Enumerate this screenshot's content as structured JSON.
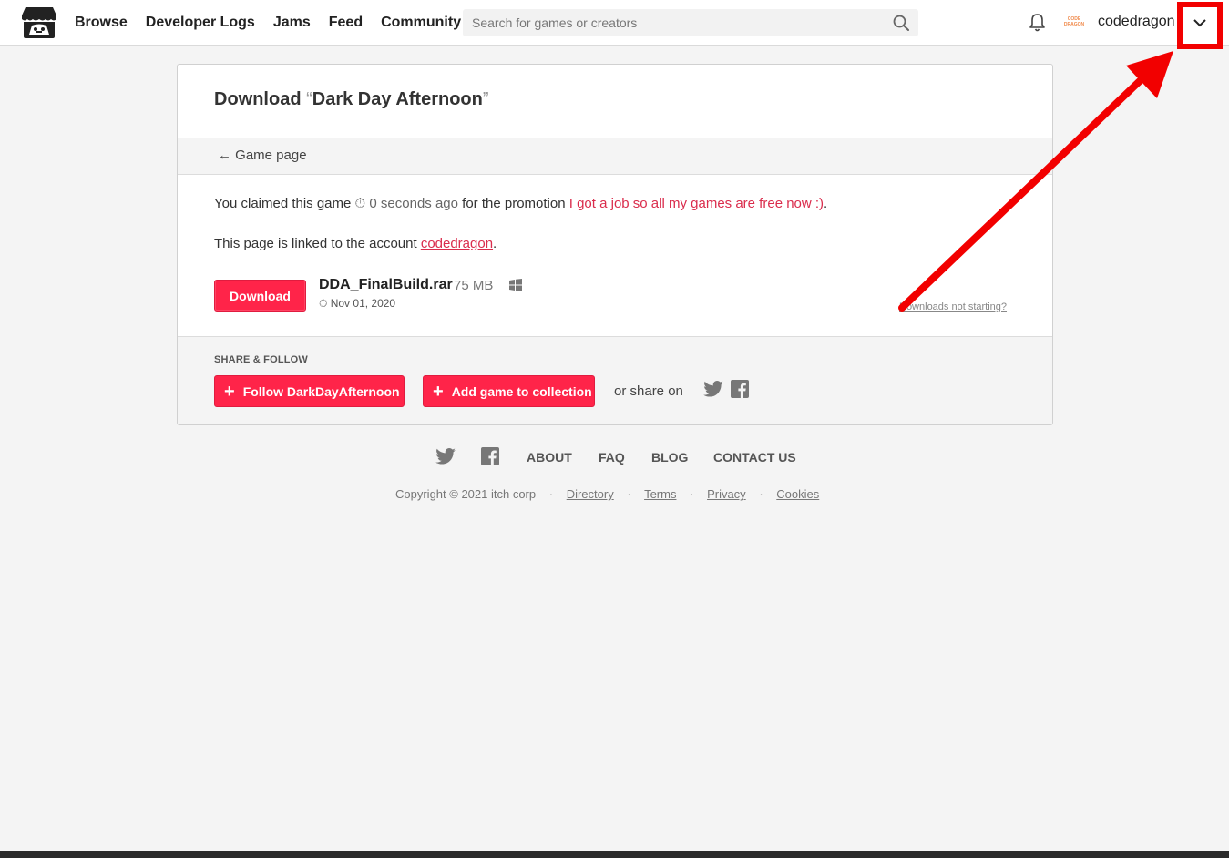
{
  "header": {
    "nav": [
      "Browse",
      "Developer Logs",
      "Jams",
      "Feed",
      "Community"
    ],
    "search_placeholder": "Search for games or creators",
    "avatar_text": "CODE DRAGON",
    "username": "codedragon"
  },
  "card": {
    "title_prefix": "Download ",
    "open_quote": "“",
    "game_title": "Dark Day Afternoon",
    "close_quote": "”",
    "back_arrow": "←",
    "back_label": "Game page",
    "claim_prefix": "You claimed this game",
    "claim_time_icon": "⏱",
    "claim_time": "0 seconds ago",
    "claim_middle": "for the promotion",
    "promotion_link": "I got a job so all my games are free now :)",
    "claim_end": ".",
    "account_prefix": "This page is linked to the account",
    "account_link": "codedragon",
    "account_end": ".",
    "download_label": "Download",
    "file_name": "DDA_FinalBuild.rar",
    "file_size": "75 MB",
    "file_date_icon": "⏱",
    "file_date": "Nov 01, 2020",
    "not_starting": "Downloads not starting?",
    "share_heading": "SHARE & FOLLOW",
    "plus_symbol": "+",
    "follow_label": "Follow DarkDayAfternoon",
    "collection_label": "Add game to collection",
    "share_text": "or share on"
  },
  "footer": {
    "links": [
      "ABOUT",
      "FAQ",
      "BLOG",
      "CONTACT US"
    ],
    "copyright": "Copyright © 2021 itch corp",
    "separator": "·",
    "legal": [
      "Directory",
      "Terms",
      "Privacy",
      "Cookies"
    ]
  },
  "icons": {
    "logo": "itch-logo-icon",
    "search": "search-icon",
    "notifications": "bell-icon",
    "dropdown": "chevron-down-icon",
    "windows": "windows-icon",
    "twitter": "twitter-icon",
    "facebook": "facebook-icon"
  },
  "colors": {
    "accent": "#ff2449",
    "link": "#da2c4c",
    "annotation": "#f20000"
  }
}
